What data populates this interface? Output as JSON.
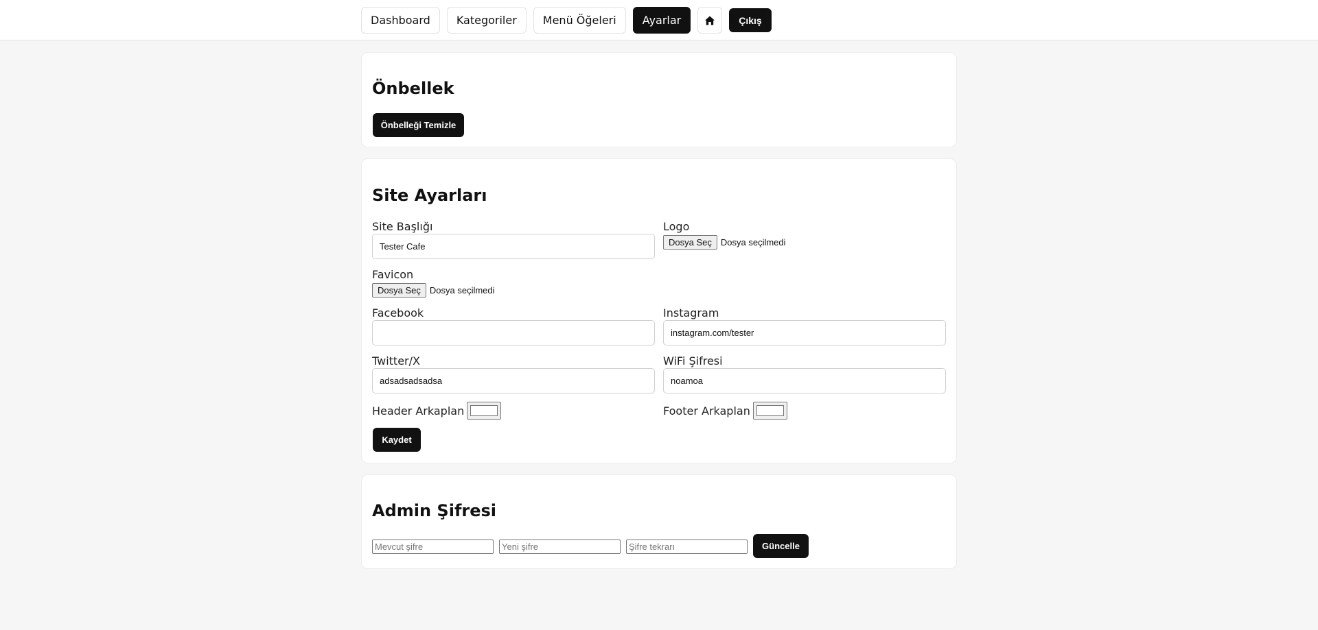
{
  "nav": {
    "dashboard": "Dashboard",
    "categories": "Kategoriler",
    "menu_items": "Menü Öğeleri",
    "settings": "Ayarlar",
    "logout": "Çıkış"
  },
  "cache": {
    "title": "Önbellek",
    "clear_button": "Önbelleği Temizle"
  },
  "site_settings": {
    "title": "Site Ayarları",
    "site_title_label": "Site Başlığı",
    "site_title_value": "Tester Cafe",
    "logo_label": "Logo",
    "favicon_label": "Favicon",
    "file_button": "Dosya Seç",
    "file_status": "Dosya seçilmedi",
    "facebook_label": "Facebook",
    "facebook_value": "",
    "instagram_label": "Instagram",
    "instagram_value": "instagram.com/tester",
    "twitter_label": "Twitter/X",
    "twitter_value": "adsadsadsadsa",
    "wifi_label": "WiFi Şifresi",
    "wifi_value": "noamoa",
    "header_bg_label": "Header Arkaplan",
    "header_bg_color": "#ffffff",
    "footer_bg_label": "Footer Arkaplan",
    "footer_bg_color": "#ffffff",
    "save_button": "Kaydet"
  },
  "admin_password": {
    "title": "Admin Şifresi",
    "current_placeholder": "Mevcut şifre",
    "new_placeholder": "Yeni şifre",
    "repeat_placeholder": "Şifre tekrarı",
    "update_button": "Güncelle"
  },
  "colors": {
    "accent": "#111111",
    "page_background": "#f6f6f6",
    "card_background": "#ffffff"
  }
}
